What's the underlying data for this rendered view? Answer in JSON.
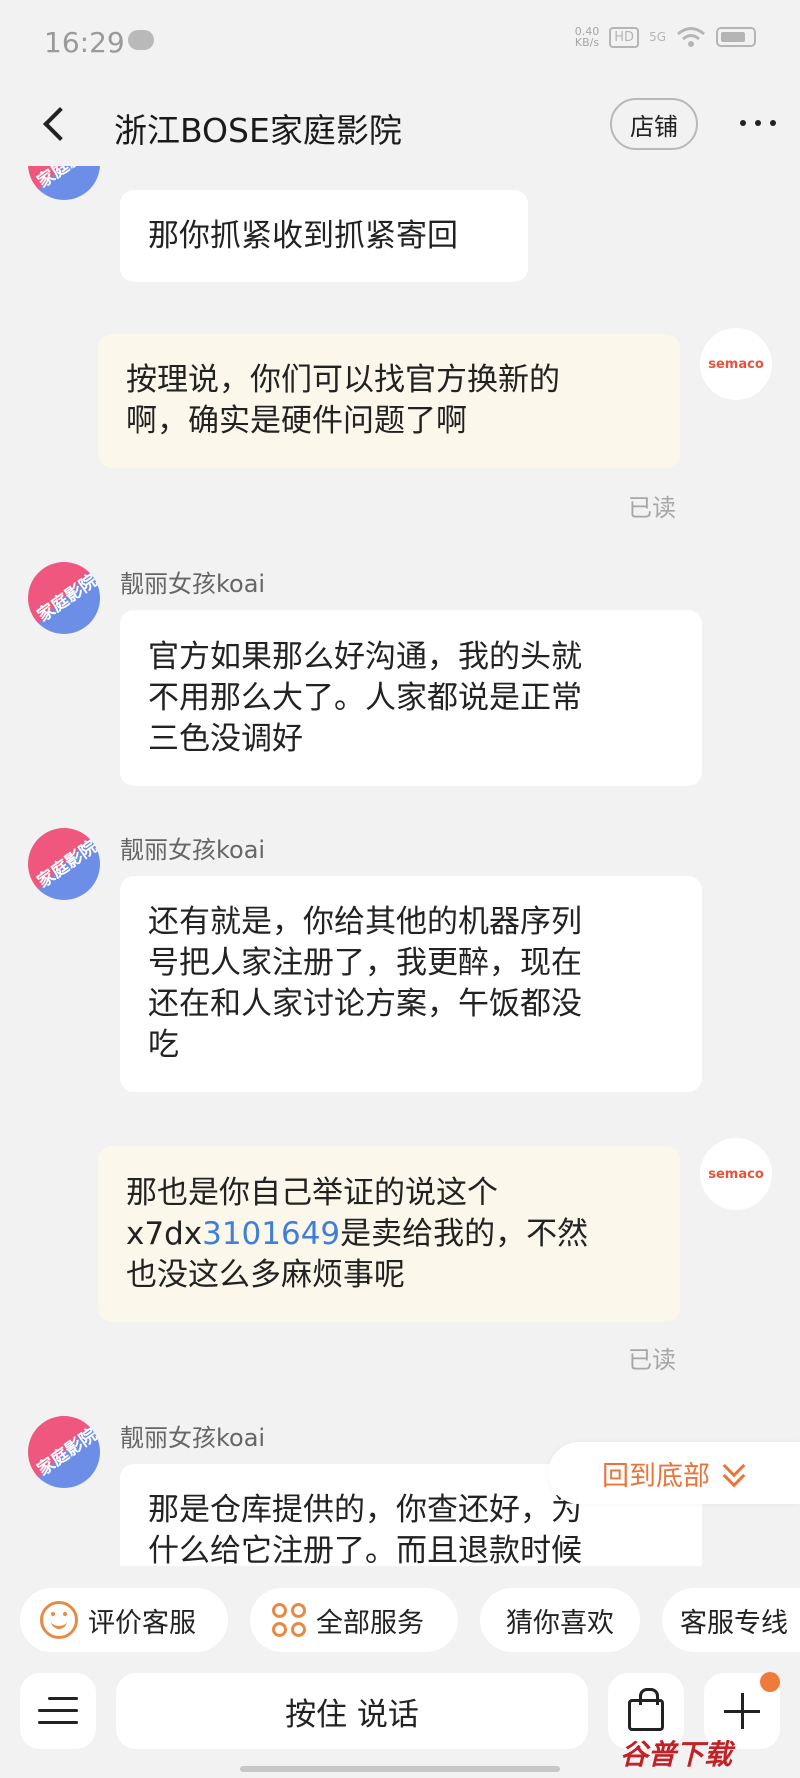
{
  "status_bar": {
    "time": "16:29",
    "net_speed_value": "0.40",
    "net_speed_unit": "KB/s",
    "hd_label": "HD",
    "signal_label": "5G"
  },
  "header": {
    "title": "浙江BOSE家庭影院",
    "shop_button": "店铺"
  },
  "chat": {
    "shop_avatar_text": "家庭影院",
    "user_avatar_text": "semaco",
    "read_label": "已读",
    "messages": [
      {
        "side": "left",
        "text": "那你抓紧收到抓紧寄回"
      },
      {
        "side": "right",
        "lines": [
          "按理说，你们可以找官方换新的",
          "啊，确实是硬件问题了啊"
        ],
        "status": "已读"
      },
      {
        "side": "left",
        "sender": "靓丽女孩koai",
        "lines": [
          "官方如果那么好沟通，我的头就",
          "不用那么大了。人家都说是正常",
          "三色没调好"
        ]
      },
      {
        "side": "left",
        "sender": "靓丽女孩koai",
        "lines": [
          "还有就是，你给其他的机器序列",
          "号把人家注册了，我更醉，现在",
          "还在和人家讨论方案，午饭都没",
          "吃"
        ]
      },
      {
        "side": "right",
        "line1": "那也是你自己举证的说这个",
        "line2_prefix": "x7dx",
        "line2_link": "3101649",
        "line2_suffix": "是卖给我的，不然",
        "line3": "也没这么多麻烦事呢",
        "status": "已读"
      },
      {
        "side": "left",
        "sender": "靓丽女孩koai",
        "lines": [
          "那是仓库提供的，你查还好，为",
          "什么给它注册了。而且退款时候"
        ]
      }
    ],
    "back_to_bottom": "回到底部"
  },
  "quick_actions": {
    "rate": "评价客服",
    "services": "全部服务",
    "guess": "猜你喜欢",
    "hotline": "客服专线"
  },
  "input_bar": {
    "voice_label": "按住 说话"
  },
  "watermark": "谷普下载",
  "colors": {
    "accent": "#e88a45",
    "link": "#3f7fd8",
    "right_bubble": "#fbf7ea",
    "background": "#f2f2f2"
  }
}
